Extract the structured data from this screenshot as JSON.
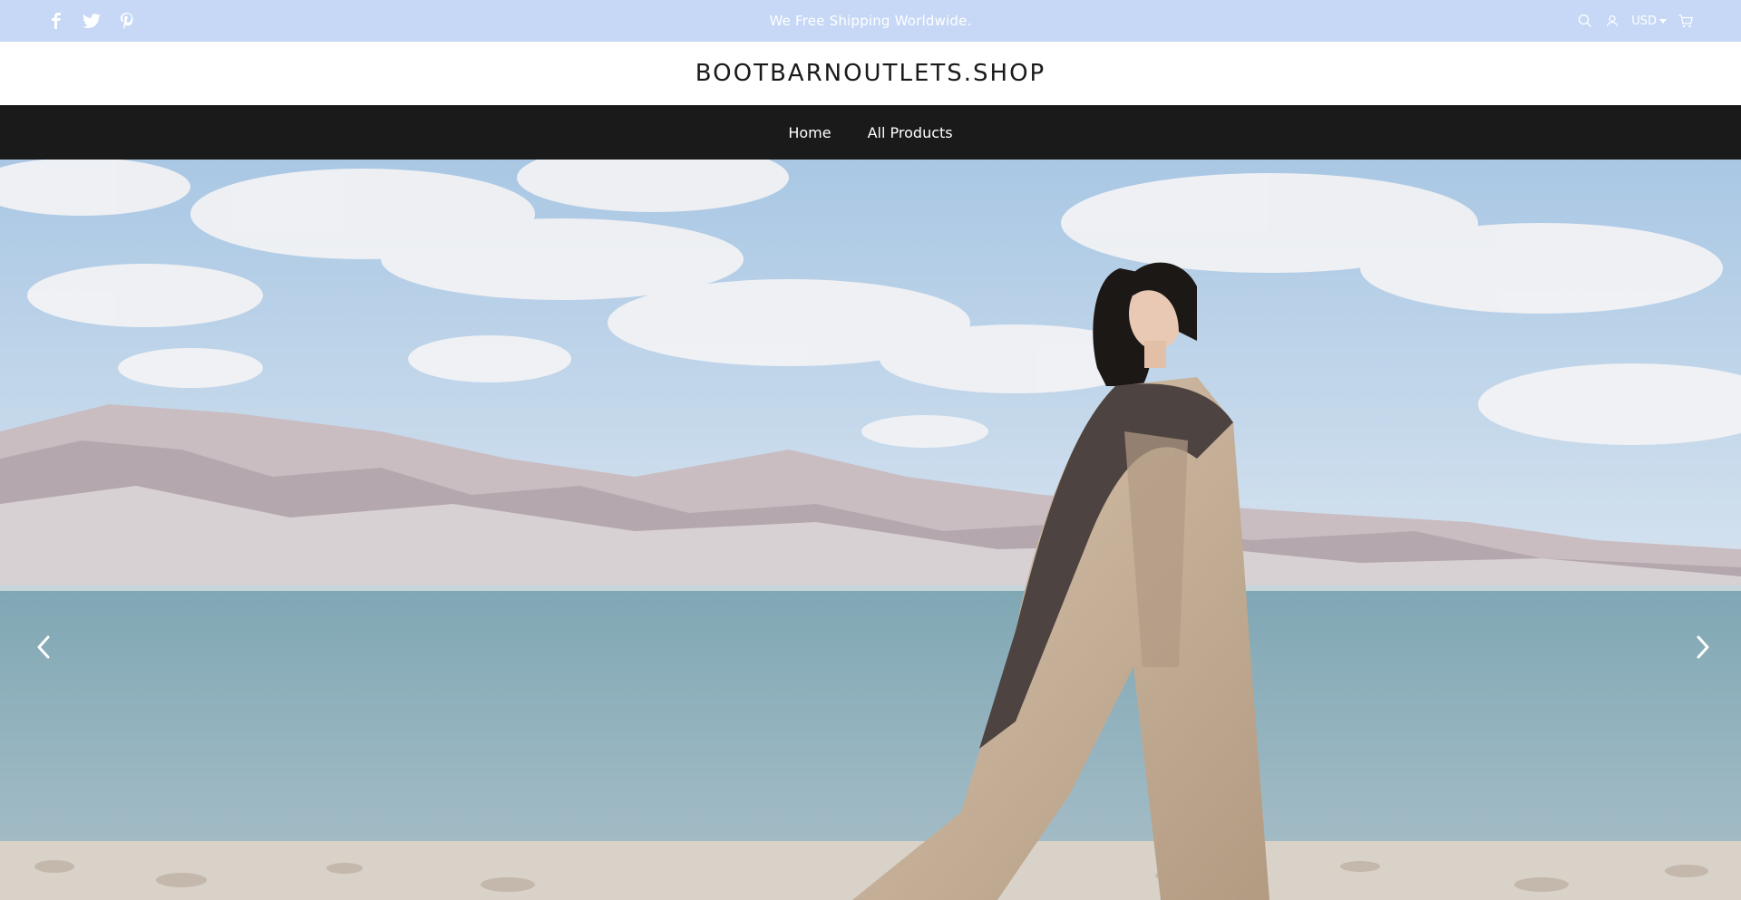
{
  "announcement": {
    "text": "We Free Shipping Worldwide."
  },
  "social": [
    {
      "icon": "facebook-icon"
    },
    {
      "icon": "twitter-icon"
    },
    {
      "icon": "pinterest-icon"
    }
  ],
  "utilities": {
    "search_icon": "search-icon",
    "account_icon": "user-icon",
    "currency": "USD",
    "cart_icon": "cart-icon"
  },
  "header": {
    "logo": "BOOTBARNOUTLETS.SHOP"
  },
  "nav": {
    "items": [
      {
        "label": "Home"
      },
      {
        "label": "All Products"
      }
    ]
  },
  "hero": {
    "prev_icon": "chevron-left-icon",
    "next_icon": "chevron-right-icon"
  },
  "colors": {
    "announcement_bg": "#c6d8f5",
    "nav_bg": "#1a1a1a",
    "sky": "#b9d3ea",
    "lake": "#8fb0ba",
    "mountains": "#bfb4b8",
    "coat": "#c8b29b"
  }
}
